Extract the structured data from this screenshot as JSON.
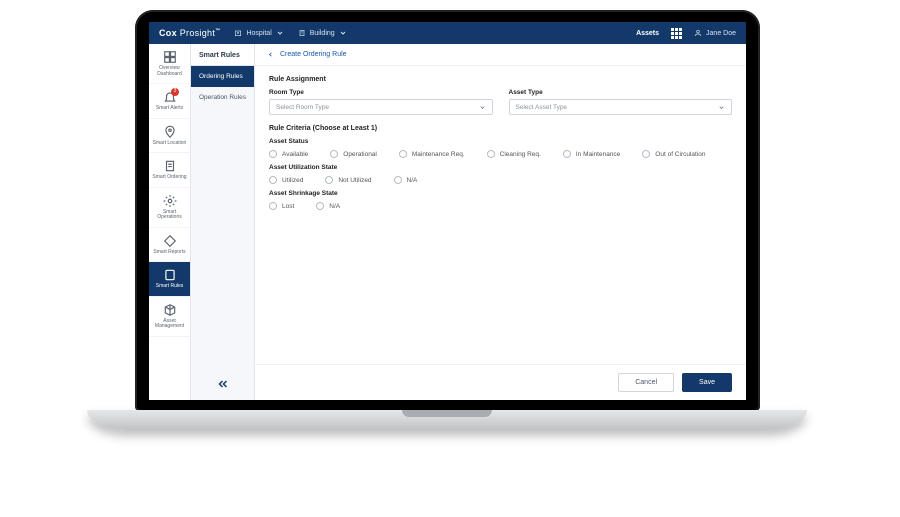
{
  "brand": {
    "part1": "Cox",
    "part2": "Prosight",
    "tm": "™"
  },
  "topnav": {
    "dd1": "Hospital",
    "dd2": "Building",
    "right_label": "Assets",
    "user": "Jane Doe"
  },
  "rail": [
    {
      "label": "Overview Dashboard",
      "icon": "dashboard"
    },
    {
      "label": "Smart Alerts",
      "icon": "bell",
      "badge": "3"
    },
    {
      "label": "Smart Location",
      "icon": "pin"
    },
    {
      "label": "Smart Ordering",
      "icon": "clipboard"
    },
    {
      "label": "Smart Operations",
      "icon": "gear"
    },
    {
      "label": "Smart Reports",
      "icon": "tag"
    },
    {
      "label": "Smart Rules",
      "icon": "rules",
      "active": true
    },
    {
      "label": "Asset Management",
      "icon": "box"
    }
  ],
  "subnav": {
    "title": "Smart Rules",
    "items": [
      {
        "label": "Ordering Rules",
        "active": true
      },
      {
        "label": "Operation Rules"
      }
    ]
  },
  "crumb": "Create Ordering Rule",
  "form": {
    "section1": "Rule Assignment",
    "room_type_label": "Room Type",
    "room_type_placeholder": "Select Room Type",
    "asset_type_label": "Asset Type",
    "asset_type_placeholder": "Select Asset Type",
    "section2": "Rule Criteria (Choose at Least 1)",
    "group_status": "Asset Status",
    "status_opts": [
      "Available",
      "Operational",
      "Maintenance Req.",
      "Cleaning Req.",
      "In Maintenance",
      "Out of Circulation"
    ],
    "group_util": "Asset Utilization State",
    "util_opts": [
      "Utilized",
      "Not Utilized",
      "N/A"
    ],
    "group_shrink": "Asset Shrinkage State",
    "shrink_opts": [
      "Lost",
      "N/A"
    ]
  },
  "footer": {
    "cancel": "Cancel",
    "save": "Save"
  }
}
